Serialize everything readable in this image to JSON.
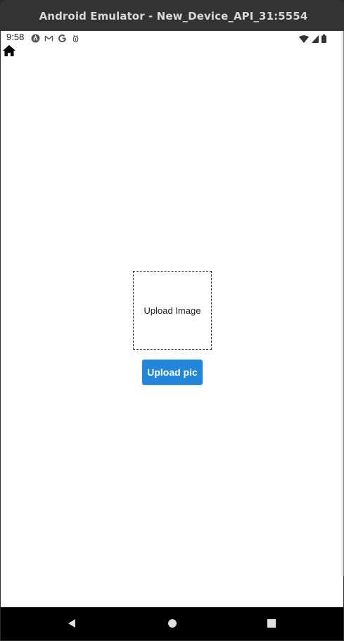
{
  "window": {
    "title": "Android Emulator - New_Device_API_31:5554"
  },
  "status_bar": {
    "time": "9:58",
    "notification_icons": [
      "android-studio-icon",
      "gmail-icon",
      "google-icon",
      "debug-icon"
    ],
    "system_icons": [
      "wifi-icon",
      "signal-icon",
      "battery-icon"
    ]
  },
  "app": {
    "upload_box_label": "Upload Image",
    "upload_button_label": "Upload pic",
    "accent_color": "#2287da"
  },
  "nav_bar": {
    "buttons": [
      "back",
      "home",
      "recents"
    ]
  }
}
